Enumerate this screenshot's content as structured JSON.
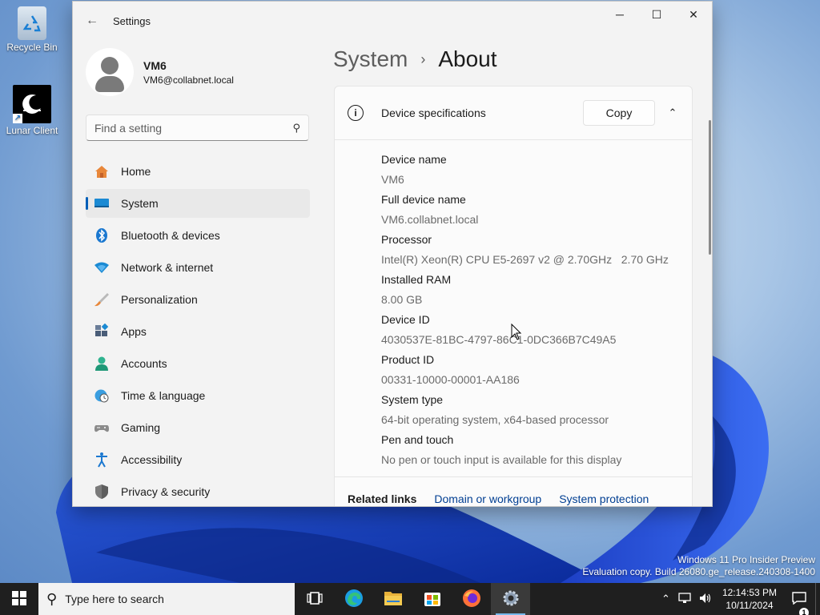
{
  "desktop": {
    "icons": [
      {
        "label": "Recycle Bin"
      },
      {
        "label": "Lunar Client"
      }
    ],
    "watermark": {
      "line1": "Windows 11 Pro Insider Preview",
      "line2": "Evaluation copy. Build 26080.ge_release.240308-1400"
    }
  },
  "window": {
    "title": "Settings",
    "back_icon": "back-arrow-icon",
    "controls": {
      "minimize": "─",
      "maximize": "☐",
      "close": "✕"
    }
  },
  "user": {
    "name": "VM6",
    "email": "VM6@collabnet.local"
  },
  "search": {
    "placeholder": "Find a setting",
    "value": ""
  },
  "nav": {
    "items": [
      {
        "label": "Home",
        "icon": "home-icon",
        "selected": false
      },
      {
        "label": "System",
        "icon": "system-display-icon",
        "selected": true
      },
      {
        "label": "Bluetooth & devices",
        "icon": "bluetooth-icon",
        "selected": false
      },
      {
        "label": "Network & internet",
        "icon": "wifi-icon",
        "selected": false
      },
      {
        "label": "Personalization",
        "icon": "brush-icon",
        "selected": false
      },
      {
        "label": "Apps",
        "icon": "apps-icon",
        "selected": false
      },
      {
        "label": "Accounts",
        "icon": "person-icon",
        "selected": false
      },
      {
        "label": "Time & language",
        "icon": "globe-clock-icon",
        "selected": false
      },
      {
        "label": "Gaming",
        "icon": "controller-icon",
        "selected": false
      },
      {
        "label": "Accessibility",
        "icon": "accessibility-icon",
        "selected": false
      },
      {
        "label": "Privacy & security",
        "icon": "shield-icon",
        "selected": false
      }
    ]
  },
  "breadcrumb": {
    "parent": "System",
    "separator": "›",
    "current": "About"
  },
  "device_specs": {
    "title": "Device specifications",
    "copy_label": "Copy",
    "collapse_glyph": "⌃",
    "rows": [
      {
        "label": "Device name",
        "value": "VM6"
      },
      {
        "label": "Full device name",
        "value": "VM6.collabnet.local"
      },
      {
        "label": "Processor",
        "value": "Intel(R) Xeon(R) CPU E5-2697 v2 @ 2.70GHz   2.70 GHz"
      },
      {
        "label": "Installed RAM",
        "value": "8.00 GB"
      },
      {
        "label": "Device ID",
        "value": "4030537E-81BC-4797-86C1-0DC366B7C49A5"
      },
      {
        "label": "Product ID",
        "value": "00331-10000-00001-AA186"
      },
      {
        "label": "System type",
        "value": "64-bit operating system, x64-based processor"
      },
      {
        "label": "Pen and touch",
        "value": "No pen or touch input is available for this display"
      }
    ]
  },
  "related_links": {
    "label": "Related links",
    "links": [
      "Domain or workgroup",
      "System protection"
    ]
  },
  "taskbar": {
    "search_placeholder": "Type here to search",
    "apps": [
      "task-view-icon",
      "edge-icon",
      "file-explorer-icon",
      "store-icon",
      "firefox-icon",
      "settings-icon"
    ],
    "clock_time": "12:14:53 PM",
    "clock_date": "10/11/2024",
    "notification_count": "1"
  },
  "colors": {
    "accent": "#005fb8",
    "link": "#003e92",
    "window_bg": "#f3f3f3",
    "card_bg": "#fbfbfb",
    "taskbar_bg": "#1f1f1f"
  }
}
